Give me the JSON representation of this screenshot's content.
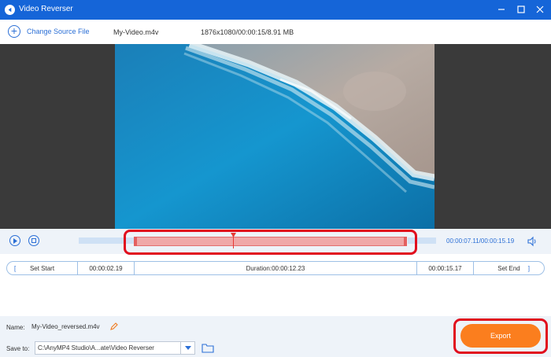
{
  "window": {
    "title": "Video Reverser",
    "controls": [
      "minimize-icon",
      "maximize-icon",
      "close-icon"
    ]
  },
  "toolbar": {
    "add_label": "Change Source File",
    "file_name": "My-Video.m4v",
    "file_info": "1876x1080/00:00:15/8.91 MB"
  },
  "player": {
    "time_readout": "00:00:07.11/00:00:15.19",
    "play_icon": "play-icon",
    "stop_icon": "stop-icon",
    "volume_icon": "volume-icon"
  },
  "trim": {
    "set_start": "Set Start",
    "start_time": "00:00:02.19",
    "duration": "Duration:00:00:12.23",
    "end_time": "00:00:15.17",
    "set_end": "Set End"
  },
  "output": {
    "name_label": "Name:",
    "name_value": "My-Video_reversed.m4v",
    "save_label": "Save to:",
    "save_path": "C:\\AnyMP4 Studio\\A...ate\\Video Reverser",
    "export_label": "Export"
  },
  "colors": {
    "titlebar": "#1565d8",
    "accent": "#2b6fd6",
    "export": "#fb7e1e",
    "highlight": "#e10e1e"
  }
}
